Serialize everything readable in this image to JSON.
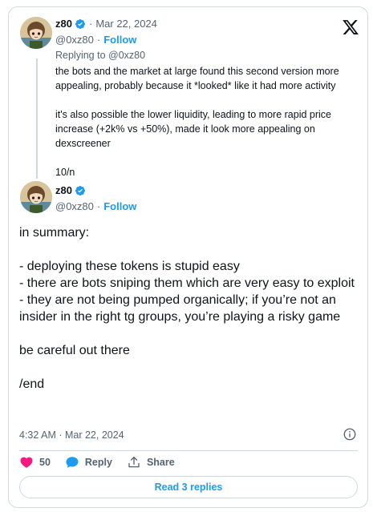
{
  "quoted_tweet": {
    "display_name": "z80",
    "date": "Mar 22, 2024",
    "handle": "@0xz80",
    "follow_label": "Follow",
    "replying_to": "Replying to @0xz80",
    "paragraphs": [
      "the bots and the market at large found this second version more appealing, probably because it *looked* like it had more activity",
      "it's also possible the lower liquidity, leading to more rapid price increase (+2k% vs +50%), made it look more appealing on dexscreener",
      "10/n"
    ]
  },
  "main_tweet": {
    "display_name": "z80",
    "handle": "@0xz80",
    "follow_label": "Follow",
    "lines": [
      "in summary:",
      "",
      "- deploying these tokens is stupid easy",
      "- there are bots sniping them which are very easy to exploit",
      "- they are not being pumped organically; if you’re not an insider in the right tg groups, you’re playing a risky game",
      "",
      "be careful out there",
      "",
      "/end"
    ],
    "timestamp": "4:32 AM · Mar 22, 2024"
  },
  "actions": {
    "like_count": "50",
    "reply_label": "Reply",
    "share_label": "Share"
  },
  "read_replies_label": "Read 3 replies",
  "colors": {
    "accent": "#1d9bf0",
    "like": "#f91880",
    "text": "#0f1419",
    "muted": "#536471",
    "border": "#cfd9de"
  },
  "icons": {
    "logo": "x-logo-icon",
    "verified": "verified-badge-icon",
    "info": "info-icon",
    "like": "heart-icon",
    "reply": "speech-bubble-icon",
    "share": "share-upload-icon"
  }
}
